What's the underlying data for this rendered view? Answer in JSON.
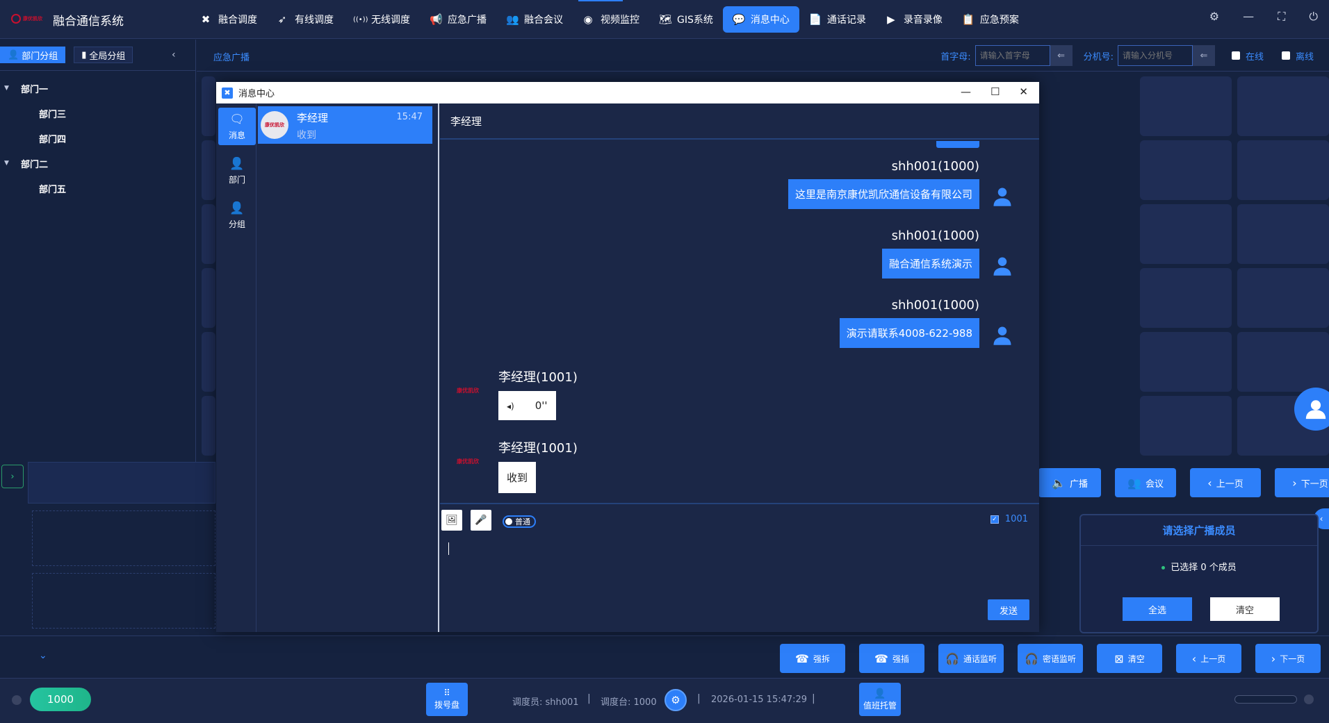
{
  "app": {
    "logo_text": "康优凯欣",
    "title": "融合通信系统"
  },
  "nav": [
    {
      "label": "融合调度",
      "icon": "cross-arrows-icon"
    },
    {
      "label": "有线调度",
      "icon": "rocket-icon"
    },
    {
      "label": "无线调度",
      "icon": "radio-waves-icon"
    },
    {
      "label": "应急广播",
      "icon": "megaphone-icon"
    },
    {
      "label": "融合会议",
      "icon": "group-icon"
    },
    {
      "label": "视频监控",
      "icon": "camera-icon"
    },
    {
      "label": "GIS系统",
      "icon": "map-icon"
    },
    {
      "label": "消息中心",
      "icon": "chat-icon",
      "active": true
    },
    {
      "label": "通话记录",
      "icon": "document-icon"
    },
    {
      "label": "录音录像",
      "icon": "video-icon"
    },
    {
      "label": "应急预案",
      "icon": "plan-icon"
    }
  ],
  "left": {
    "tab_dept": "部门分组",
    "tab_global": "全局分组",
    "tree": [
      {
        "label": "部门一",
        "level": 1
      },
      {
        "label": "部门三",
        "level": 2
      },
      {
        "label": "部门四",
        "level": 2
      },
      {
        "label": "部门二",
        "level": 1
      },
      {
        "label": "部门五",
        "level": 2
      }
    ]
  },
  "crumb": "应急广播",
  "filters": {
    "initial_label": "首字母:",
    "initial_placeholder": "请输入首字母",
    "ext_label": "分机号:",
    "ext_placeholder": "请输入分机号",
    "online": "在线",
    "offline": "离线"
  },
  "actions_top": [
    "广播",
    "会议",
    "上一页",
    "下一页"
  ],
  "actions_bottom": [
    "强拆",
    "强插",
    "通话监听",
    "密语监听",
    "清空",
    "上一页",
    "下一页"
  ],
  "broadcast": {
    "title": "请选择广播成员",
    "count_text": "已选择 0 个成员",
    "select_all": "全选",
    "clear": "清空"
  },
  "status": {
    "extension": "1000",
    "dialpad": "拨号盘",
    "dispatcher": "调度员: shh001",
    "console": "调度台: 1000",
    "datetime": "2026-01-15 15:47:29",
    "duty": "值班托管"
  },
  "modal": {
    "title": "消息中心",
    "rail": [
      "消息",
      "部门",
      "分组"
    ],
    "conversation": {
      "name": "李经理",
      "last": "收到",
      "time": "15:47",
      "avatar_text": "康优凯欣"
    },
    "chat_title": "李经理",
    "messages": [
      {
        "side": "right",
        "sender": "shh001(1000)",
        "text": "这里是南京康优凯欣通信设备有限公司"
      },
      {
        "side": "right",
        "sender": "shh001(1000)",
        "text": "融合通信系统演示"
      },
      {
        "side": "right",
        "sender": "shh001(1000)",
        "text": "演示请联系4008-622-988"
      },
      {
        "side": "left",
        "sender": "李经理(1001)",
        "text": "0''",
        "voice": true
      },
      {
        "side": "left",
        "sender": "李经理(1001)",
        "text": "收到"
      }
    ],
    "mode": "普通",
    "receiver": "1001",
    "send": "发送"
  }
}
